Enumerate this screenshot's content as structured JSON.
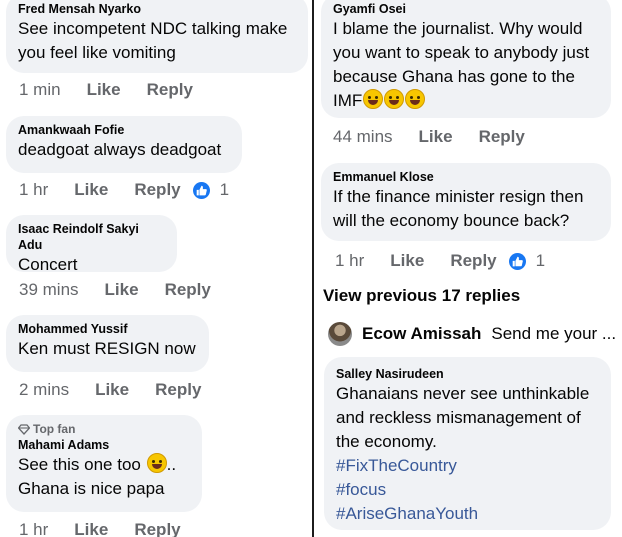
{
  "left_column": {
    "comments": [
      {
        "name": "Fred Mensah Nyarko",
        "lines": [
          "See incompetent NDC talking make",
          "you feel like vomiting"
        ],
        "time": "1 min",
        "like": "Like",
        "reply": "Reply"
      },
      {
        "name": "Amankwaah Fofie",
        "lines": [
          "deadgoat always deadgoat"
        ],
        "time": "1 hr",
        "like": "Like",
        "reply": "Reply",
        "reaction_count": "1"
      },
      {
        "name": "Isaac Reindolf Sakyi Adu",
        "lines": [
          "Concert"
        ],
        "time": "39 mins",
        "like": "Like",
        "reply": "Reply"
      },
      {
        "name": "Mohammed Yussif",
        "lines": [
          "Ken must RESIGN now"
        ],
        "time": "2 mins",
        "like": "Like",
        "reply": "Reply"
      },
      {
        "badge": "Top fan",
        "name": "Mahami Adams",
        "lines": [
          "See this one too",
          "..",
          "Ghana is nice papa"
        ],
        "time": "1 hr",
        "like": "Like",
        "reply": "Reply"
      }
    ]
  },
  "right_column": {
    "comments": [
      {
        "name": "Gyamfi Osei",
        "lines": [
          "I blame the journalist. Why would",
          "you want to speak to anybody just",
          "because Ghana has gone to the",
          "IMF"
        ],
        "time": "44 mins",
        "like": "Like",
        "reply": "Reply"
      },
      {
        "name": "Emmanuel Klose",
        "lines": [
          "If the finance minister resign then",
          "will the economy bounce back?"
        ],
        "time": "1 hr",
        "like": "Like",
        "reply": "Reply",
        "reaction_count": "1"
      },
      {
        "name": "Salley Nasirudeen",
        "lines": [
          "Ghanaians never see unthinkable",
          "and reckless mismanagement of",
          "the economy."
        ],
        "hashtags": [
          "#FixTheCountry",
          "#focus",
          "#AriseGhanaYouth"
        ]
      }
    ],
    "view_previous": "View previous 17 replies",
    "reply_preview": {
      "name": "Ecow Amissah",
      "text": "Send me your ..."
    }
  },
  "colors": {
    "bubble": "#f0f2f5",
    "meta": "#65676b",
    "hashtag": "#385898",
    "like_badge": "#1877f2"
  }
}
